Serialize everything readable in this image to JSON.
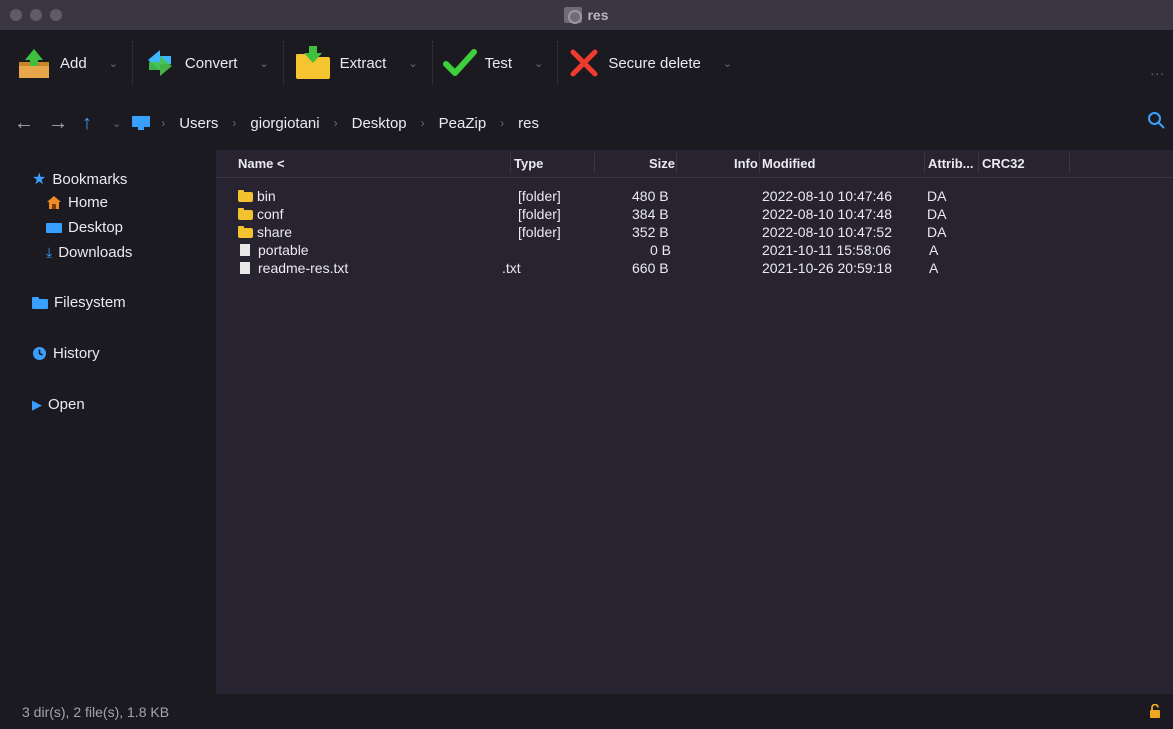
{
  "window": {
    "title": "res"
  },
  "toolbar": {
    "add": "Add",
    "convert": "Convert",
    "extract": "Extract",
    "test": "Test",
    "secure_delete": "Secure delete",
    "more": "..."
  },
  "address": {
    "crumbs": [
      "Users",
      "giorgiotani",
      "Desktop",
      "PeaZip",
      "res"
    ]
  },
  "sidebar": {
    "bookmarks": "Bookmarks",
    "items": [
      "Home",
      "Desktop",
      "Downloads"
    ],
    "filesystem": "Filesystem",
    "history": "History",
    "open": "Open"
  },
  "columns": {
    "name": "Name <",
    "type": "Type",
    "size": "Size",
    "info": "Info",
    "modified": "Modified",
    "attrib": "Attrib...",
    "crc32": "CRC32"
  },
  "files": [
    {
      "name": "bin",
      "kind": "folder",
      "type": "[folder]",
      "size": "480 B",
      "modified": "2022-08-10 10:47:46",
      "attrib": "DA"
    },
    {
      "name": "conf",
      "kind": "folder",
      "type": "[folder]",
      "size": "384 B",
      "modified": "2022-08-10 10:47:48",
      "attrib": "DA"
    },
    {
      "name": "share",
      "kind": "folder",
      "type": "[folder]",
      "size": "352 B",
      "modified": "2022-08-10 10:47:52",
      "attrib": "DA"
    },
    {
      "name": "portable",
      "kind": "file",
      "type": "",
      "size": "0 B",
      "modified": "2021-10-11 15:58:06",
      "attrib": "A"
    },
    {
      "name": "readme-res.txt",
      "kind": "file",
      "type": ".txt",
      "size": "660 B",
      "modified": "2021-10-26 20:59:18",
      "attrib": "A"
    }
  ],
  "status": {
    "summary": "3 dir(s), 2 file(s), 1.8 KB"
  },
  "colors": {
    "accent": "#3aa0ff",
    "folder": "#f2c230",
    "panel": "#272330",
    "background": "#1c1a21"
  }
}
